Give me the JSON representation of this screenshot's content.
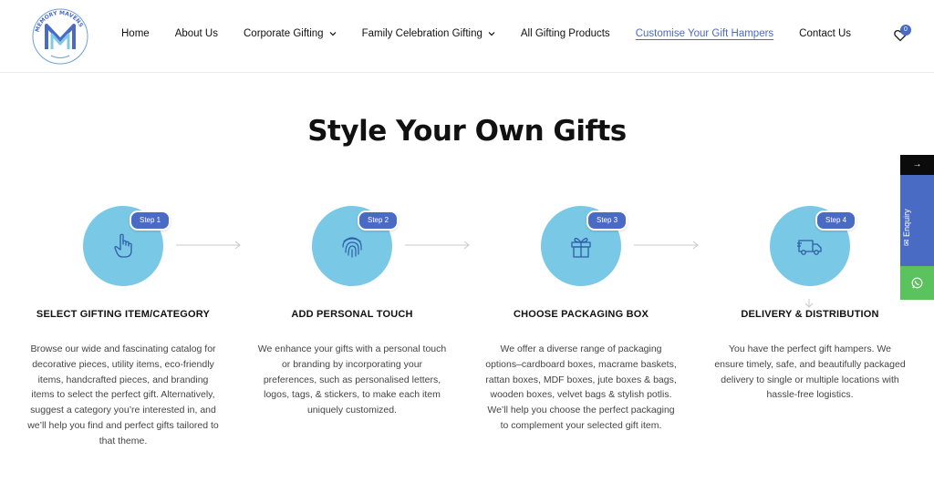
{
  "brand": {
    "logo_text": "MEMORY MAVENS",
    "logo_subtext": "Cherish Every Moment",
    "accent": "#4a6bc4"
  },
  "nav": {
    "items": [
      {
        "label": "Home"
      },
      {
        "label": "About Us"
      },
      {
        "label": "Corporate Gifting"
      },
      {
        "label": "Family Celebration Gifting"
      },
      {
        "label": "All Gifting Products"
      },
      {
        "label": "Customise Your Gift Hampers"
      },
      {
        "label": "Contact Us"
      }
    ],
    "cart_count": "0"
  },
  "page": {
    "title": "Style Your Own Gifts"
  },
  "steps": [
    {
      "badge": "Step 1",
      "icon": "hand-pointer-icon",
      "title": "SELECT GIFTING ITEM/CATEGORY",
      "description": "Browse our wide and fascinating catalog for decorative pieces, utility items, eco-friendly items, handcrafted pieces, and branding items to select the perfect gift. Alternatively, suggest a category you’re interested in, and we’ll help you find and perfect gifts tailored to that theme."
    },
    {
      "badge": "Step 2",
      "icon": "fingerprint-icon",
      "title": "ADD PERSONAL TOUCH",
      "description": "We enhance your gifts with a personal touch or branding by incorporating your preferences, such as personalised letters, logos, tags, & stickers, to make each item uniquely customized."
    },
    {
      "badge": "Step 3",
      "icon": "gift-box-icon",
      "title": "CHOOSE PACKAGING BOX",
      "description": "We offer a diverse range of packaging options–cardboard boxes, macrame baskets, rattan boxes, MDF boxes, jute boxes & bags, wooden boxes, velvet bags & stylish potlis. We’ll help you choose the perfect packaging to complement your selected gift item."
    },
    {
      "badge": "Step 4",
      "icon": "delivery-truck-icon",
      "title": "DELIVERY & DISTRIBUTION",
      "description": "You have the perfect gift hampers. We ensure timely, safe, and beautifully packaged delivery to single or multiple locations with hassle-free logistics."
    }
  ],
  "sidebar_widgets": {
    "enquiry_label": "Enquiry",
    "arrow_label": "→"
  },
  "colors": {
    "circle": "#78c8e6",
    "badge": "#4a6bc4",
    "whatsapp": "#5ac35e"
  }
}
